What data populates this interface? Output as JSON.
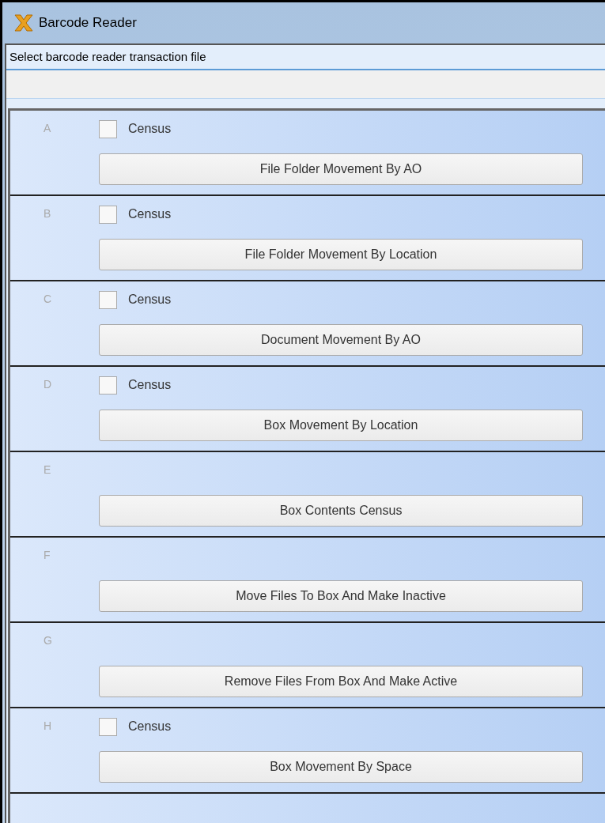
{
  "window": {
    "title": "Barcode Reader"
  },
  "file_prompt": "Select barcode reader transaction file",
  "sections": [
    {
      "letter": "A",
      "census": {
        "label": "Census",
        "checked": false
      },
      "button": "File Folder Movement By AO"
    },
    {
      "letter": "B",
      "census": {
        "label": "Census",
        "checked": false
      },
      "button": "File Folder Movement By Location"
    },
    {
      "letter": "C",
      "census": {
        "label": "Census",
        "checked": false
      },
      "button": "Document Movement By AO"
    },
    {
      "letter": "D",
      "census": {
        "label": "Census",
        "checked": false
      },
      "button": "Box Movement By Location"
    },
    {
      "letter": "E",
      "button": "Box Contents Census"
    },
    {
      "letter": "F",
      "button": "Move Files To Box And Make Inactive"
    },
    {
      "letter": "G",
      "button": "Remove Files From Box And Make Active"
    },
    {
      "letter": "H",
      "census": {
        "label": "Census",
        "checked": false
      },
      "button": "Box Movement By Space"
    }
  ]
}
